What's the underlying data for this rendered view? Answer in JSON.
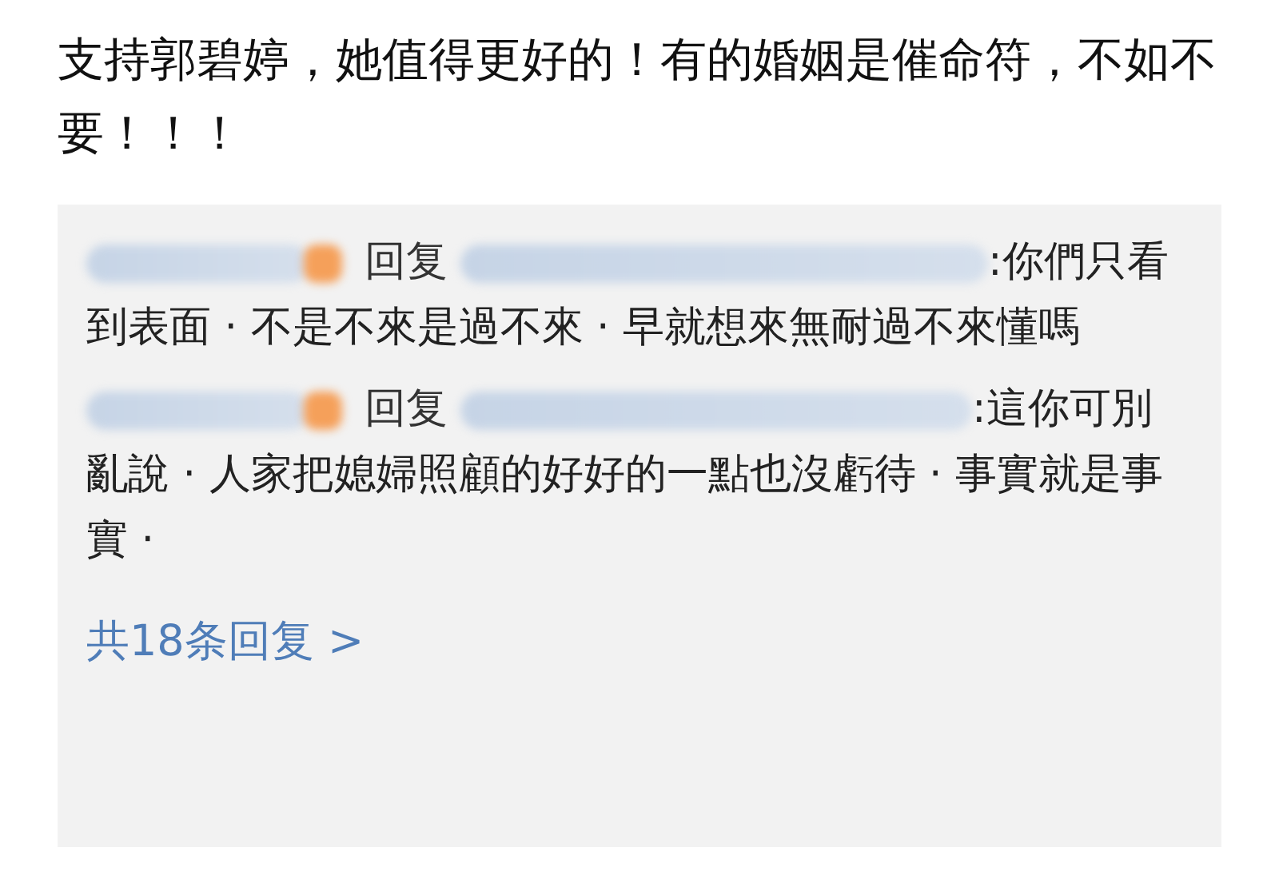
{
  "comment": {
    "text": "支持郭碧婷，她值得更好的！有的婚姻是催命符，不如不要！！！"
  },
  "replies": [
    {
      "reply_word": "回复",
      "text": ":你們只看到表面 · 不是不來是過不來 · 早就想來無耐過不來懂嗎"
    },
    {
      "reply_word": "回复",
      "text": ":這你可別亂說 · 人家把媳婦照顧的好好的一點也沒虧待 · 事實就是事實 ·"
    }
  ],
  "more_replies": "共18条回复 >"
}
